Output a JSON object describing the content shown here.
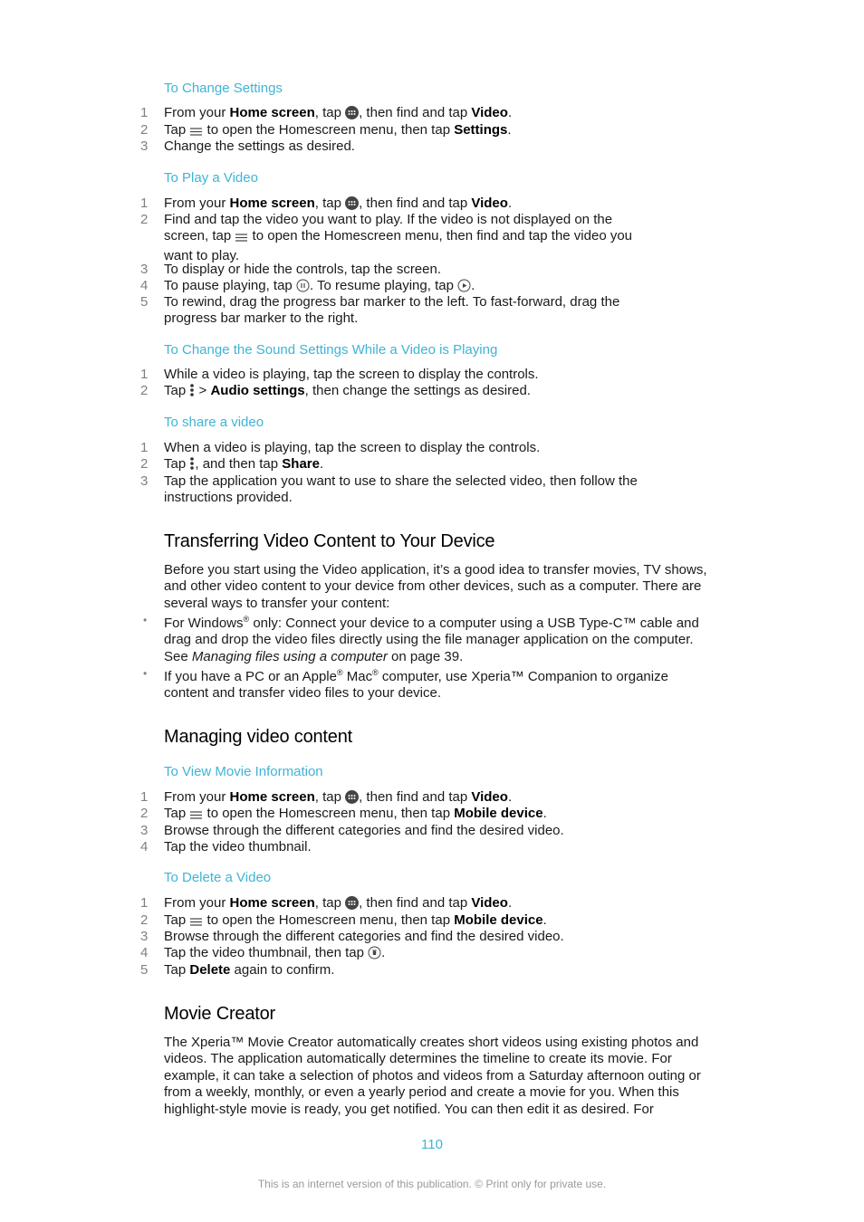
{
  "procedures": {
    "change_settings": {
      "title": "To Change Settings",
      "steps": [
        {
          "num": "1",
          "a": "From your ",
          "b1": "Home screen",
          "c": ", tap ",
          "icon": "apps-grid-icon",
          "d": ", then find and tap ",
          "b2": "Video",
          "e": "."
        },
        {
          "num": "2",
          "a": "Tap ",
          "icon": "menu-icon",
          "c": " to open the Homescreen menu, then tap ",
          "b1": "Settings",
          "e": "."
        },
        {
          "num": "3",
          "text": "Change the settings as desired."
        }
      ]
    },
    "play_video": {
      "title": "To Play a Video",
      "steps": [
        {
          "num": "1",
          "a": "From your ",
          "b1": "Home screen",
          "c": ", tap ",
          "icon": "apps-grid-icon",
          "d": ", then find and tap ",
          "b2": "Video",
          "e": "."
        },
        {
          "num": "2",
          "a": "Find and tap the video you want to play. If the video is not displayed on the screen, tap ",
          "icon": "menu-icon",
          "c": " to open the Homescreen menu, then find and tap the video you want to play."
        },
        {
          "num": "3",
          "text": "To display or hide the controls, tap the screen."
        },
        {
          "num": "4",
          "a": "To pause playing, tap ",
          "icon": "pause-icon",
          "c": ". To resume playing, tap ",
          "icon2": "play-icon",
          "e": "."
        },
        {
          "num": "5",
          "text": "To rewind, drag the progress bar marker to the left. To fast-forward, drag the progress bar marker to the right."
        }
      ]
    },
    "sound_settings": {
      "title": "To Change the Sound Settings While a Video is Playing",
      "steps": [
        {
          "num": "1",
          "text": "While a video is playing, tap the screen to display the controls."
        },
        {
          "num": "2",
          "a": "Tap ",
          "icon": "more-options-icon",
          "c": " > ",
          "b1": "Audio settings",
          "e": ", then change the settings as desired."
        }
      ]
    },
    "share_video": {
      "title": "To share a video",
      "steps": [
        {
          "num": "1",
          "text": "When a video is playing, tap the screen to display the controls."
        },
        {
          "num": "2",
          "a": "Tap ",
          "icon": "more-options-icon",
          "c": ", and then tap ",
          "b1": "Share",
          "e": "."
        },
        {
          "num": "3",
          "text": "Tap the application you want to use to share the selected video, then follow the instructions provided."
        }
      ]
    },
    "view_movie_info": {
      "title": "To View Movie Information",
      "steps": [
        {
          "num": "1",
          "a": "From your ",
          "b1": "Home screen",
          "c": ", tap ",
          "icon": "apps-grid-icon",
          "d": ", then find and tap ",
          "b2": "Video",
          "e": "."
        },
        {
          "num": "2",
          "a": "Tap ",
          "icon": "menu-icon",
          "c": " to open the Homescreen menu, then tap ",
          "b1": "Mobile device",
          "e": "."
        },
        {
          "num": "3",
          "text": "Browse through the different categories and find the desired video."
        },
        {
          "num": "4",
          "text": "Tap the video thumbnail."
        }
      ]
    },
    "delete_video": {
      "title": "To Delete a Video",
      "steps": [
        {
          "num": "1",
          "a": "From your ",
          "b1": "Home screen",
          "c": ", tap ",
          "icon": "apps-grid-icon",
          "d": ", then find and tap ",
          "b2": "Video",
          "e": "."
        },
        {
          "num": "2",
          "a": "Tap ",
          "icon": "menu-icon",
          "c": " to open the Homescreen menu, then tap ",
          "b1": "Mobile device",
          "e": "."
        },
        {
          "num": "3",
          "text": "Browse through the different categories and find the desired video."
        },
        {
          "num": "4",
          "a": "Tap the video thumbnail, then tap ",
          "icon": "delete-icon",
          "e": "."
        },
        {
          "num": "5",
          "a": "Tap ",
          "b1": "Delete",
          "e": " again to confirm."
        }
      ]
    }
  },
  "sections": {
    "transferring": {
      "title": "Transferring Video Content to Your Device",
      "intro": "Before you start using the Video application, it’s a good idea to transfer movies, TV shows, and other video content to your device from other devices, such as a computer. There are several ways to transfer your content:",
      "bullets": [
        {
          "a": "For Windows",
          "sup1": "®",
          "b": " only: Connect your device to a computer using a USB Type-C™ cable and drag and drop the video files directly using the file manager application on the computer. See ",
          "link": "Managing files using a computer",
          "c": " on page 39."
        },
        {
          "a": "If you have a PC or an Apple",
          "sup1": "®",
          "b": " Mac",
          "sup2": "®",
          "c": " computer, use Xperia™ Companion to organize content and transfer video files to your device."
        }
      ]
    },
    "managing": {
      "title": "Managing video content"
    },
    "movie_creator": {
      "title": "Movie Creator",
      "body": "The Xperia™ Movie Creator automatically creates short videos using existing photos and videos. The application automatically determines the timeline to create its movie. For example, it can take a selection of photos and videos from a Saturday afternoon outing or from a weekly, monthly, or even a yearly period and create a movie for you. When this highlight-style movie is ready, you get notified. You can then edit it as desired. For"
    }
  },
  "footer": {
    "page_number": "110",
    "note": "This is an internet version of this publication. © Print only for private use."
  },
  "colors": {
    "accent": "#3eb4d6",
    "step_number": "#808080",
    "body_text": "#1a1a1a",
    "footer_note": "#9a9a9a"
  }
}
